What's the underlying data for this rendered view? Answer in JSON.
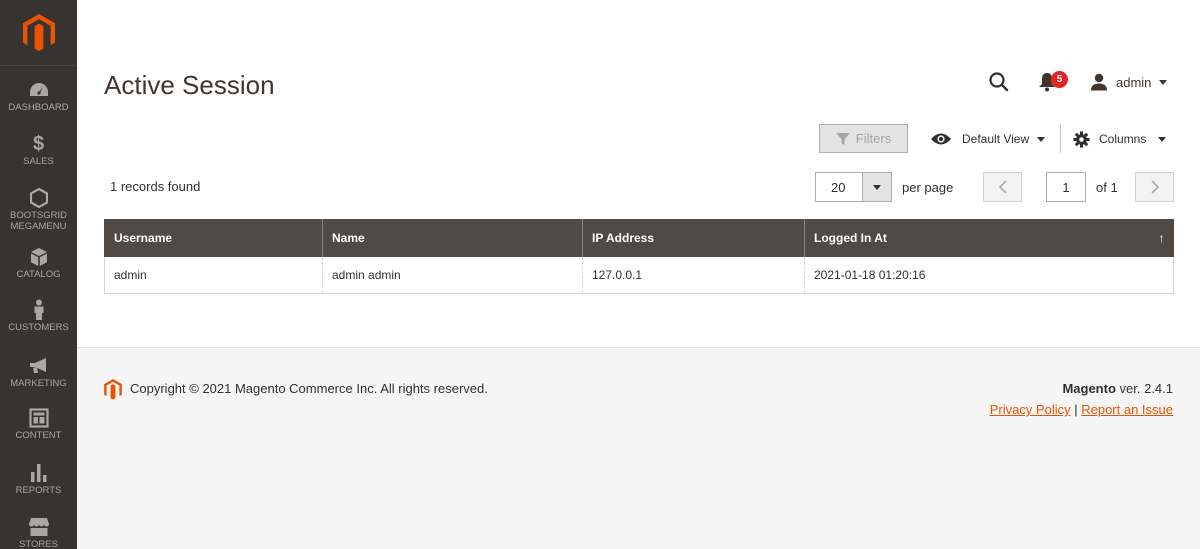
{
  "sidebar": {
    "items": [
      {
        "label": "DASHBOARD",
        "icon": "dashboard-icon"
      },
      {
        "label": "SALES",
        "icon": "dollar-icon"
      },
      {
        "label": "BOOTSGRID",
        "label2": "MEGAMENU",
        "icon": "hexagon-icon"
      },
      {
        "label": "CATALOG",
        "icon": "box-icon"
      },
      {
        "label": "CUSTOMERS",
        "icon": "person-icon"
      },
      {
        "label": "MARKETING",
        "icon": "megaphone-icon"
      },
      {
        "label": "CONTENT",
        "icon": "layout-icon"
      },
      {
        "label": "REPORTS",
        "icon": "bar-chart-icon"
      },
      {
        "label": "STORES",
        "icon": "store-icon"
      }
    ]
  },
  "header": {
    "title": "Active Session",
    "notifications_count": "5",
    "user_name": "admin"
  },
  "toolbar": {
    "filters_label": "Filters",
    "view_label": "Default View",
    "columns_label": "Columns",
    "records_found": "1 records found",
    "per_page_value": "20",
    "per_page_label": "per page",
    "current_page": "1",
    "of_pages": "of 1"
  },
  "table": {
    "headers": [
      "Username",
      "Name",
      "IP Address",
      "Logged In At"
    ],
    "sort_indicator": "↑",
    "rows": [
      [
        "admin",
        "admin admin",
        "127.0.0.1",
        "2021-01-18 01:20:16"
      ]
    ]
  },
  "footer": {
    "copyright": "Copyright © 2021 Magento Commerce Inc. All rights reserved.",
    "brand": "Magento",
    "version": " ver. 2.4.1",
    "privacy_link": "Privacy Policy",
    "separator": " | ",
    "report_link": "Report an Issue"
  },
  "colors": {
    "sidebar_bg": "#373330",
    "accent": "#eb5202",
    "table_header_bg": "#514943",
    "badge": "#e22626"
  }
}
